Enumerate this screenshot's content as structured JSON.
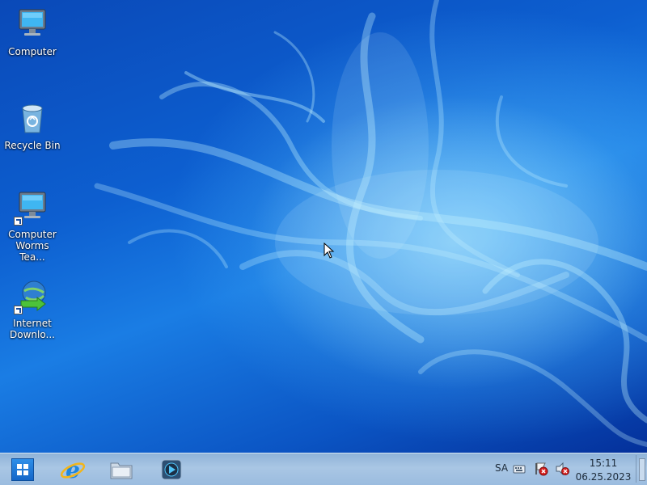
{
  "desktop": {
    "icons": [
      {
        "label_line1": "Computer",
        "label_line2": "",
        "icon": "computer-icon"
      },
      {
        "label_line1": "Recycle Bin",
        "label_line2": "",
        "icon": "recycle-bin-icon"
      },
      {
        "label_line1": "Computer",
        "label_line2": "Worms Tea...",
        "icon": "computer-shortcut-icon"
      },
      {
        "label_line1": "Internet",
        "label_line2": "Downlo...",
        "icon": "internet-download-manager-icon"
      }
    ]
  },
  "taskbar": {
    "pinned": [
      {
        "name": "start-button",
        "icon": "windows-logo-icon"
      },
      {
        "name": "internet-explorer-button",
        "icon": "internet-explorer-icon"
      },
      {
        "name": "file-explorer-button",
        "icon": "folder-icon"
      },
      {
        "name": "media-player-button",
        "icon": "media-player-icon"
      }
    ],
    "tray": {
      "language": "SA",
      "icons": [
        "keyboard-icon",
        "flag-alert-icon",
        "speaker-muted-icon"
      ],
      "time": "15:11",
      "date": "06.25.2023"
    }
  },
  "colors": {
    "wallpaper_base": "#0d5fd0",
    "taskbar": "#a9c6e4",
    "start_button": "#1466c8"
  }
}
